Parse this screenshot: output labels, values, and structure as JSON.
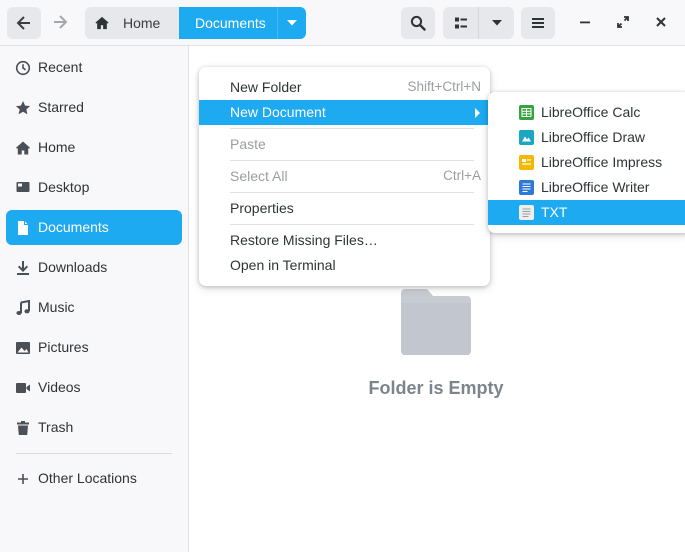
{
  "header": {
    "path": [
      {
        "label": "Home",
        "icon": "home-icon"
      },
      {
        "label": "Documents",
        "icon": "chevron-down-icon"
      }
    ],
    "buttons": [
      "back-icon",
      "forward-icon",
      "search-icon",
      "view-list-icon",
      "view-options-icon",
      "hamburger-menu-icon",
      "minimize-icon",
      "maximize-icon",
      "close-icon"
    ]
  },
  "sidebar": {
    "items": [
      {
        "label": "Recent",
        "icon": "clock-icon",
        "active": false
      },
      {
        "label": "Starred",
        "icon": "star-icon",
        "active": false
      },
      {
        "label": "Home",
        "icon": "home-icon",
        "active": false
      },
      {
        "label": "Desktop",
        "icon": "desktop-icon",
        "active": false
      },
      {
        "label": "Documents",
        "icon": "document-icon",
        "active": true
      },
      {
        "label": "Downloads",
        "icon": "download-icon",
        "active": false
      },
      {
        "label": "Music",
        "icon": "music-icon",
        "active": false
      },
      {
        "label": "Pictures",
        "icon": "picture-icon",
        "active": false
      },
      {
        "label": "Videos",
        "icon": "video-icon",
        "active": false
      },
      {
        "label": "Trash",
        "icon": "trash-icon",
        "active": false
      }
    ],
    "other_locations": {
      "label": "Other Locations",
      "icon": "plus-icon"
    }
  },
  "main": {
    "empty_label": "Folder is Empty",
    "empty_icon": "folder-icon"
  },
  "context_menu": {
    "items": [
      {
        "label": "New Folder",
        "accel": "Shift+Ctrl+N"
      },
      {
        "label": "New Document",
        "accel": "",
        "highlighted": true,
        "submenu": true
      },
      {
        "label": "Paste",
        "accel": "",
        "disabled": true
      },
      {
        "label": "Select All",
        "accel": "Ctrl+A",
        "disabled": true
      },
      {
        "label": "Properties",
        "accel": ""
      },
      {
        "label": "Restore Missing Files…",
        "accel": ""
      },
      {
        "label": "Open in Terminal",
        "accel": ""
      }
    ]
  },
  "submenu": {
    "items": [
      {
        "label": "LibreOffice Calc",
        "icon": "spreadsheet-icon",
        "color": "#36a341"
      },
      {
        "label": "LibreOffice Draw",
        "icon": "drawing-icon",
        "color": "#1ba6c2"
      },
      {
        "label": "LibreOffice Impress",
        "icon": "presentation-icon",
        "color": "#f5b800"
      },
      {
        "label": "LibreOffice Writer",
        "icon": "text-document-icon",
        "color": "#2c7ad6"
      },
      {
        "label": "TXT",
        "icon": "text-file-icon",
        "color": "#e8e8e8",
        "highlighted": true
      }
    ]
  },
  "colors": {
    "accent": "#1eaaf1",
    "sidebar_bg": "#f8f8fa",
    "muted_text": "#7e848d"
  }
}
